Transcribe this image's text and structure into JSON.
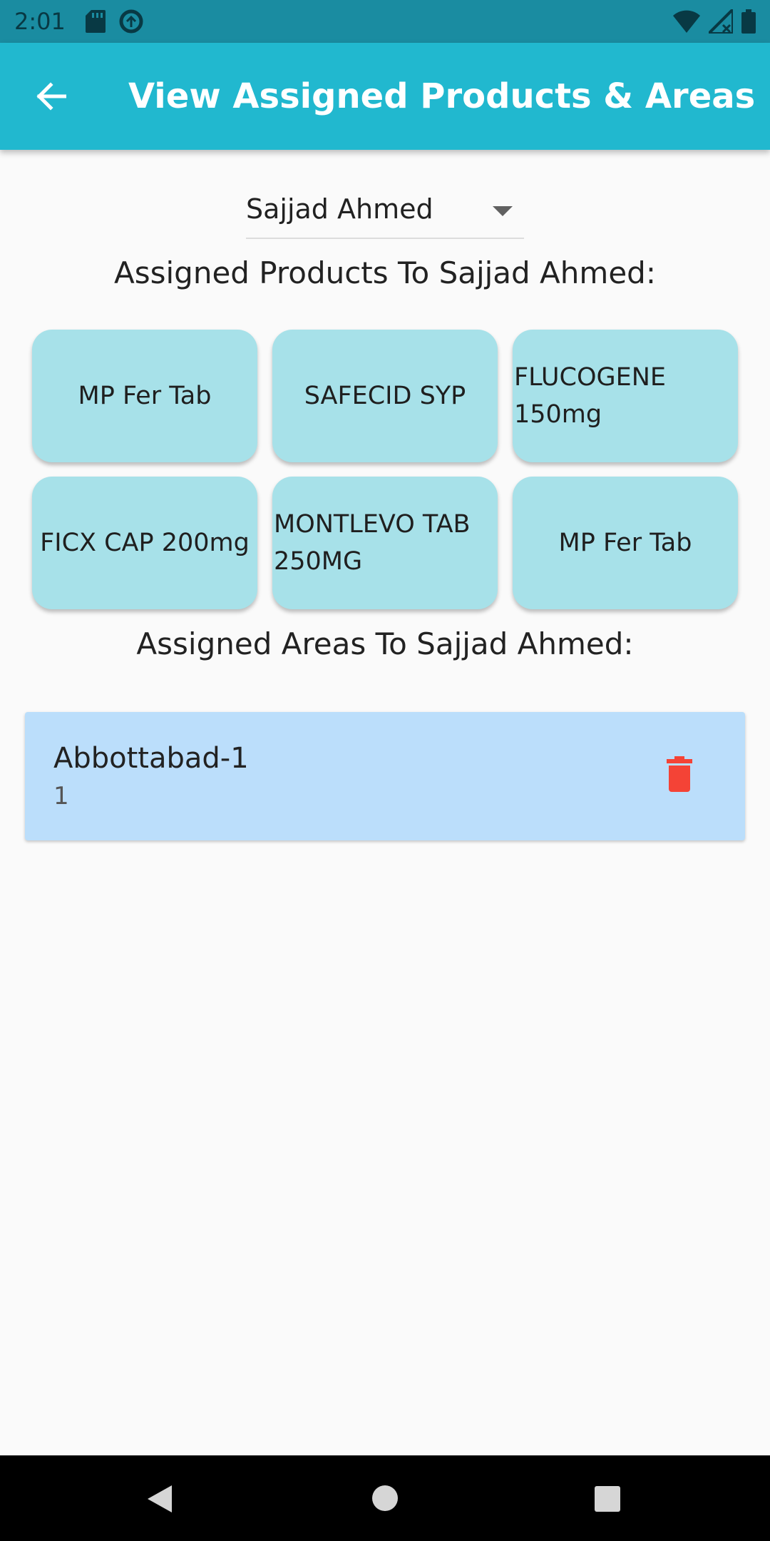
{
  "status_bar": {
    "time": "2:01",
    "icons": [
      "sd-card-icon",
      "data-saver-icon",
      "wifi-icon",
      "signal-icon",
      "battery-icon"
    ]
  },
  "app_bar": {
    "title": "View Assigned Products & Areas",
    "back_icon": "arrow-left-icon",
    "color": "#21b8cf"
  },
  "dropdown": {
    "selected": "Sajjad Ahmed"
  },
  "products_section": {
    "title": "Assigned Products To Sajjad Ahmed:",
    "items": [
      {
        "label": "MP Fer Tab"
      },
      {
        "label": "SAFECID SYP"
      },
      {
        "label": "FLUCOGENE 150mg"
      },
      {
        "label": "FICX CAP 200mg"
      },
      {
        "label": "MONTLEVO TAB 250MG"
      },
      {
        "label": "MP Fer Tab"
      }
    ],
    "card_color": "#a7e1e9"
  },
  "areas_section": {
    "title": "Assigned Areas To Sajjad Ahmed:",
    "items": [
      {
        "name": "Abbottabad-1",
        "sub": "1",
        "delete_icon": "trash-icon"
      }
    ],
    "card_color": "#bbdefb",
    "delete_color": "#f44336"
  },
  "nav_bar": {
    "icons": [
      "nav-back-icon",
      "nav-home-icon",
      "nav-recents-icon"
    ]
  }
}
